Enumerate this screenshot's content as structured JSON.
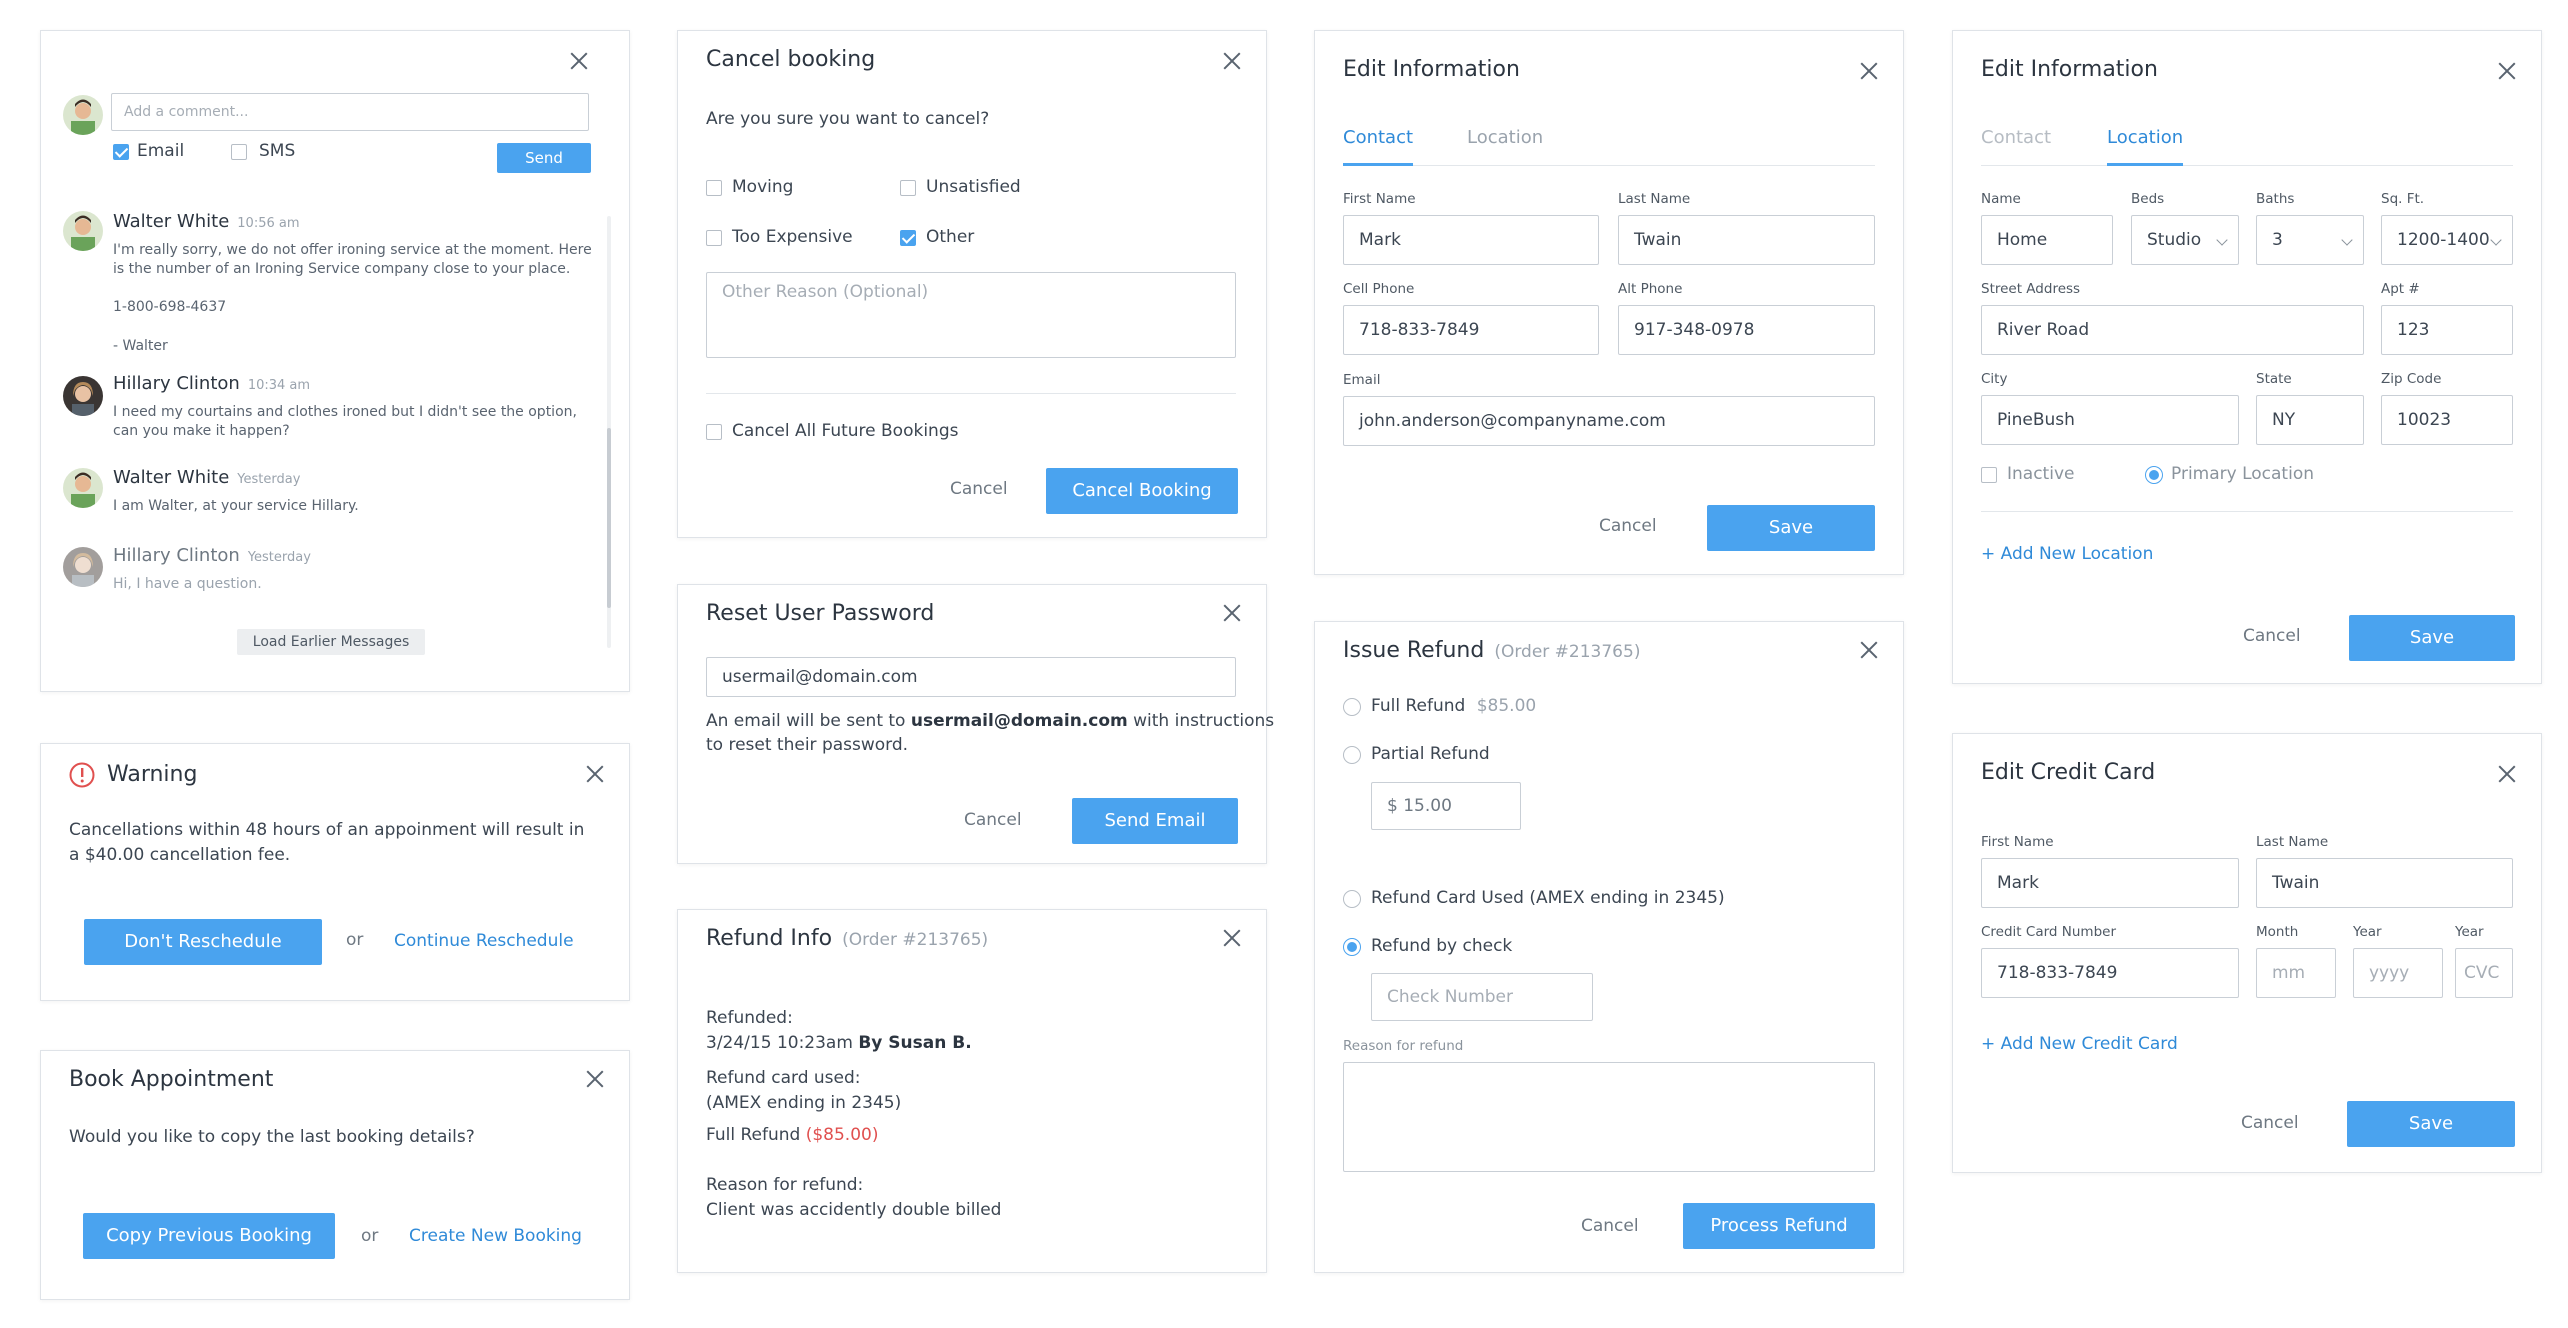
{
  "chat": {
    "comment_placeholder": "Add a comment...",
    "email_label": "Email",
    "sms_label": "SMS",
    "send_label": "Send",
    "messages": [
      {
        "name": "Walter White",
        "time": "10:56 am",
        "body": "I'm really sorry, we do not offer ironing service at the moment. Here is the number of an Ironing Service company close to your place.",
        "extra1": "1-800-698-4637",
        "extra2": "- Walter"
      },
      {
        "name": "Hillary Clinton",
        "time": "10:34 am",
        "body": "I need my courtains and clothes ironed but I didn't see the option, can you make it happen?"
      },
      {
        "name": "Walter White",
        "time": "Yesterday",
        "body": "I am Walter, at your service Hillary."
      },
      {
        "name": "Hillary Clinton",
        "time": "Yesterday",
        "body": "Hi, I have a question."
      }
    ],
    "load_more_label": "Load Earlier Messages"
  },
  "warning": {
    "title": "Warning",
    "body": "Cancellations within 48 hours of an appoinment will result in a $40.00 cancellation fee.",
    "primary_label": "Don't Reschedule",
    "or_label": "or",
    "link_label": "Continue Reschedule"
  },
  "book": {
    "title": "Book Appointment",
    "body": "Would you like to copy the last booking details?",
    "primary_label": "Copy Previous Booking",
    "or_label": "or",
    "link_label": "Create New Booking"
  },
  "cancel_booking": {
    "title": "Cancel booking",
    "question": "Are you sure you want to cancel?",
    "reasons": [
      {
        "label": "Moving",
        "checked": false
      },
      {
        "label": "Unsatisfied",
        "checked": false
      },
      {
        "label": "Too Expensive",
        "checked": false
      },
      {
        "label": "Other",
        "checked": true
      }
    ],
    "other_placeholder": "Other Reason (Optional)",
    "future_label": "Cancel All Future Bookings",
    "cancel_label": "Cancel",
    "submit_label": "Cancel Booking"
  },
  "reset_password": {
    "title": "Reset User Password",
    "email_value": "usermail@domain.com",
    "note_prefix": "An email will be sent to",
    "note_email": "usermail@domain.com",
    "note_suffix": "with instructions",
    "note_line2": "to reset their password.",
    "cancel_label": "Cancel",
    "submit_label": "Send Email"
  },
  "refund_info": {
    "title": "Refund Info",
    "order": "(Order #213765)",
    "refunded_label": "Refunded:",
    "refunded_date": "3/24/15 10:23am",
    "refunded_by": "By Susan B.",
    "card_label": "Refund card used:",
    "card_value": "(AMEX ending in 2345)",
    "full_refund_label": "Full Refund",
    "full_refund_amount": "($85.00)",
    "reason_label": "Reason for refund:",
    "reason_value": "Client was accidently double billed"
  },
  "edit_contact": {
    "title": "Edit Information",
    "tabs": [
      "Contact",
      "Location"
    ],
    "first_name_label": "First Name",
    "first_name": "Mark",
    "last_name_label": "Last Name",
    "last_name": "Twain",
    "cell_label": "Cell Phone",
    "cell": "718-833-7849",
    "alt_label": "Alt Phone",
    "alt": "917-348-0978",
    "email_label": "Email",
    "email": "john.anderson@companyname.com",
    "cancel_label": "Cancel",
    "save_label": "Save"
  },
  "issue_refund": {
    "title": "Issue Refund",
    "order": "(Order #213765)",
    "full_label": "Full Refund",
    "full_amount": "$85.00",
    "partial_label": "Partial Refund",
    "partial_amount": "$ 15.00",
    "card_label": "Refund Card Used (AMEX ending in 2345)",
    "check_label": "Refund by check",
    "check_placeholder": "Check Number",
    "reason_label": "Reason for refund",
    "cancel_label": "Cancel",
    "submit_label": "Process Refund"
  },
  "edit_location": {
    "title": "Edit Information",
    "tabs": [
      "Contact",
      "Location"
    ],
    "name_label": "Name",
    "name": "Home",
    "beds_label": "Beds",
    "beds": "Studio",
    "baths_label": "Baths",
    "baths": "3",
    "sqft_label": "Sq. Ft.",
    "sqft": "1200-1400",
    "street_label": "Street Address",
    "street": "River Road",
    "apt_label": "Apt #",
    "apt": "123",
    "city_label": "City",
    "city": "PineBush",
    "state_label": "State",
    "state": "NY",
    "zip_label": "Zip Code",
    "zip": "10023",
    "inactive_label": "Inactive",
    "primary_label": "Primary Location",
    "add_label": "+ Add New Location",
    "cancel_label": "Cancel",
    "save_label": "Save"
  },
  "credit_card": {
    "title": "Edit Credit Card",
    "first_name_label": "First Name",
    "first_name": "Mark",
    "last_name_label": "Last Name",
    "last_name": "Twain",
    "number_label": "Credit Card Number",
    "number": "718-833-7849",
    "month_label": "Month",
    "month_placeholder": "mm",
    "year_label": "Year",
    "year_placeholder": "yyyy",
    "cvc_label": "Year",
    "cvc_placeholder": "CVC",
    "add_label": "+ Add New Credit Card",
    "cancel_label": "Cancel",
    "save_label": "Save"
  },
  "colors": {
    "accent": "#4aa3ef",
    "link": "#2f8ad8",
    "danger": "#e0504f"
  }
}
